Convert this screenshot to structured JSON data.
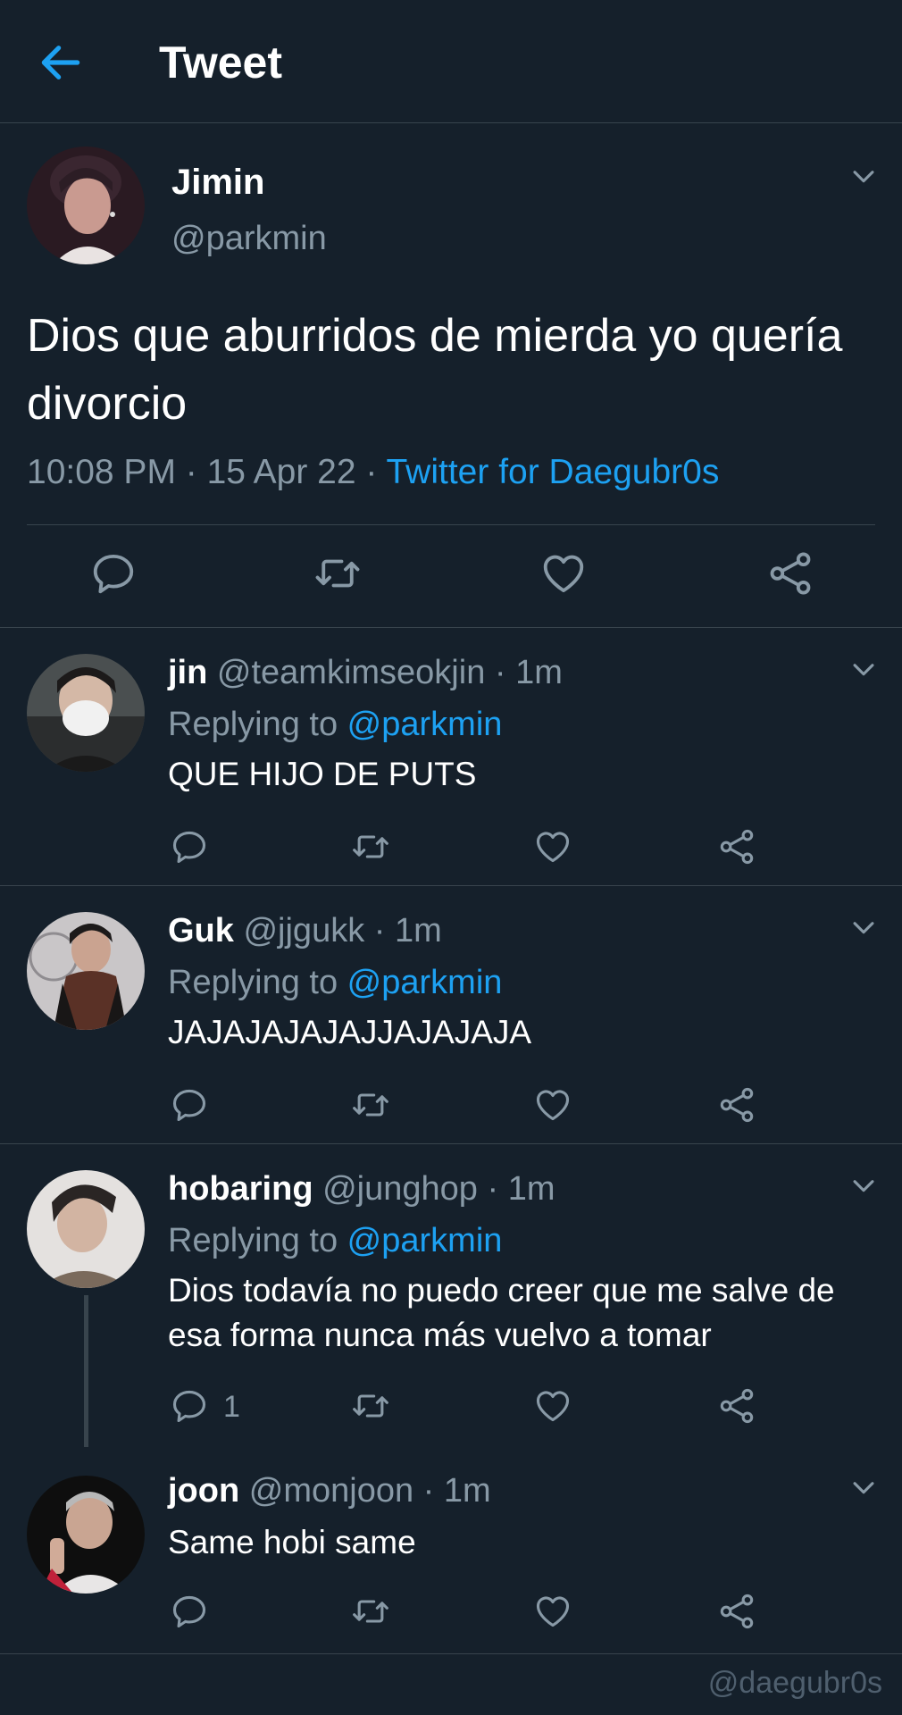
{
  "header": {
    "title": "Tweet",
    "back_icon": "arrow-left-icon"
  },
  "main_tweet": {
    "name": "Jimin",
    "handle": "@parkmin",
    "text": "Dios que aburridos de mierda yo quería divorcio",
    "time_date": "10:08 PM · 15 Apr 22 · ",
    "source": "Twitter for Daegubr0s"
  },
  "replies": [
    {
      "name": "jin",
      "handle": "@teamkimseokjin · 1m",
      "replying_prefix": "Replying to ",
      "replying_handle": "@parkmin",
      "text": "QUE HIJO DE PUTS"
    },
    {
      "name": "Guk",
      "handle": "@jjgukk · 1m",
      "replying_prefix": "Replying to ",
      "replying_handle": "@parkmin",
      "text": "JAJAJAJAJAJJAJAJAJA"
    },
    {
      "name": "hobaring",
      "handle": "@junghop · 1m",
      "replying_prefix": "Replying to ",
      "replying_handle": "@parkmin",
      "text": "Dios todavía no puedo creer que me salve de esa forma nunca más vuelvo a tomar",
      "reply_count": "1"
    },
    {
      "name": "joon",
      "handle": "@monjoon · 1m",
      "text": "Same hobi same"
    }
  ],
  "watermark": "@daegubr0s",
  "colors": {
    "background": "#15202b",
    "accent": "#1da1f2",
    "muted": "#8899a6",
    "divider": "#38444d"
  }
}
